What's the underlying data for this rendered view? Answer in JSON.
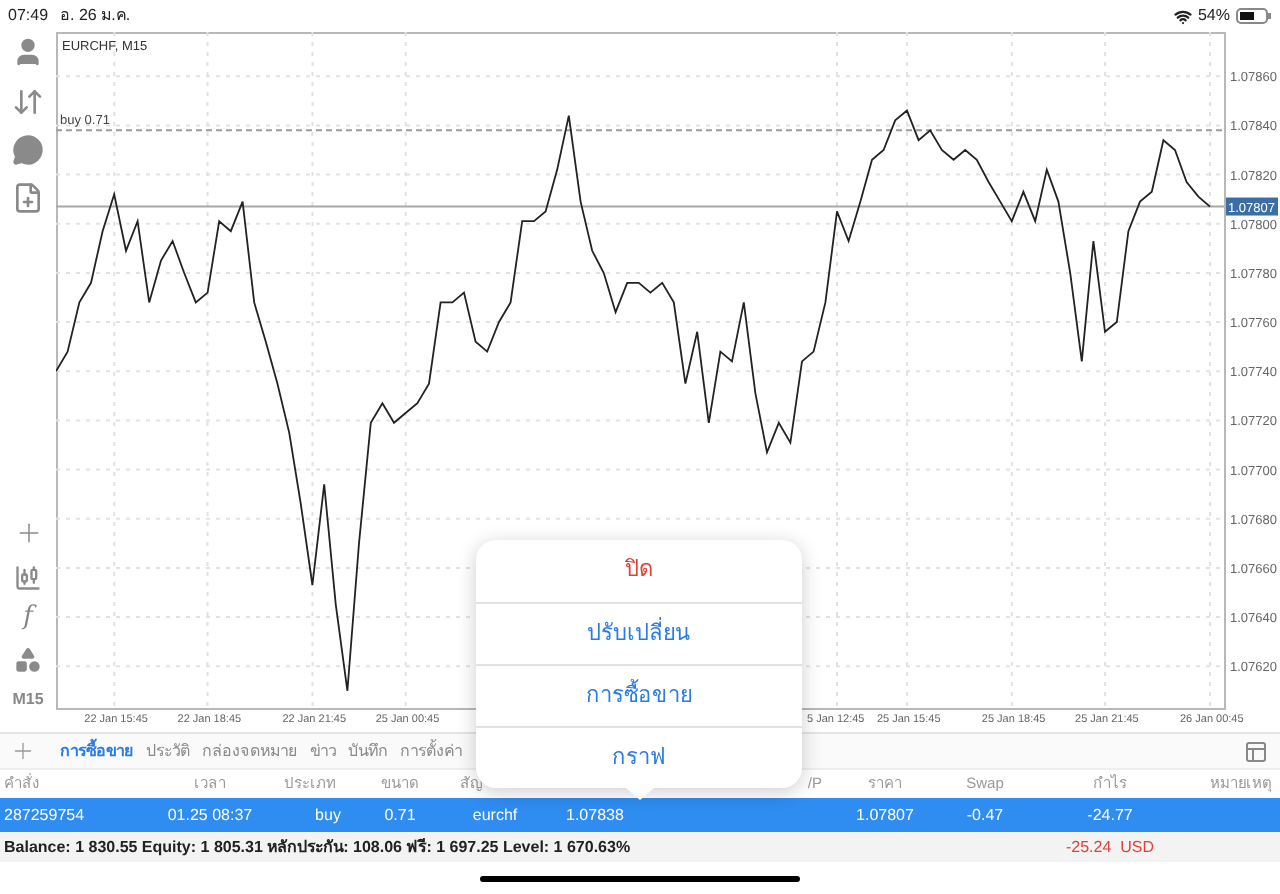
{
  "status_bar": {
    "time": "07:49",
    "date": "อ. 26 ม.ค.",
    "battery": "54%"
  },
  "toolbar": {
    "function_glyph": "f",
    "timeframe": "M15"
  },
  "chart": {
    "title": "EURCHF, M15",
    "chart_data": {
      "type": "line",
      "grid": true,
      "ylim": [
        1.07603,
        1.07878
      ],
      "categories": [
        null,
        null,
        null,
        null,
        null,
        "22 Jan 15:45",
        null,
        null,
        null,
        null,
        null,
        null,
        null,
        "22 Jan 18:45",
        null,
        null,
        null,
        null,
        null,
        null,
        null,
        null,
        "22 Jan 21:45",
        null,
        null,
        null,
        null,
        null,
        null,
        null,
        "25 Jan 00:45",
        null,
        null,
        null,
        null,
        null,
        null,
        null,
        null,
        null,
        null,
        null,
        null,
        null,
        null,
        null,
        null,
        null,
        null,
        null,
        null,
        null,
        null,
        null,
        null,
        null,
        null,
        null,
        null,
        null,
        null,
        null,
        null,
        null,
        null,
        null,
        null,
        "5 Jan 12:45",
        null,
        null,
        null,
        null,
        null,
        "25 Jan 15:45",
        null,
        null,
        null,
        null,
        null,
        null,
        null,
        null,
        "25 Jan 18:45",
        null,
        null,
        null,
        null,
        null,
        null,
        null,
        "25 Jan 21:45",
        null,
        null,
        null,
        null,
        null,
        null,
        null,
        null,
        "26 Jan 00:45"
      ],
      "yticks": [
        {
          "value": 1.0762,
          "label": "1.07620"
        },
        {
          "value": 1.0764,
          "label": "1.07640"
        },
        {
          "value": 1.0766,
          "label": "1.07660"
        },
        {
          "value": 1.0768,
          "label": "1.07680"
        },
        {
          "value": 1.077,
          "label": "1.07700"
        },
        {
          "value": 1.0772,
          "label": "1.07720"
        },
        {
          "value": 1.0774,
          "label": "1.07740"
        },
        {
          "value": 1.0776,
          "label": "1.07760"
        },
        {
          "value": 1.0778,
          "label": "1.07780"
        },
        {
          "value": 1.078,
          "label": "1.07800"
        },
        {
          "value": 1.0782,
          "label": "1.07820"
        },
        {
          "value": 1.0784,
          "label": "1.07840"
        },
        {
          "value": 1.0786,
          "label": "1.07860"
        }
      ],
      "series": [
        {
          "color": "#222222",
          "values": [
            1.0774,
            1.07748,
            1.07768,
            1.07776,
            1.07797,
            1.07812,
            1.07789,
            1.07801,
            1.07768,
            1.07785,
            1.07793,
            1.0778,
            1.07768,
            1.07772,
            1.07801,
            1.07797,
            1.07809,
            1.07768,
            1.07752,
            1.07735,
            1.07715,
            1.07686,
            1.07653,
            1.07694,
            1.07645,
            1.0761,
            1.0767,
            1.07719,
            1.07727,
            1.07719,
            1.07723,
            1.07727,
            1.07735,
            1.07768,
            1.07768,
            1.07772,
            1.07752,
            1.07748,
            1.0776,
            1.07768,
            1.07801,
            1.07801,
            1.07805,
            1.07822,
            1.07844,
            1.07809,
            1.07789,
            1.0778,
            1.07764,
            1.07776,
            1.07776,
            1.07772,
            1.07776,
            1.07768,
            1.07735,
            1.07756,
            1.07719,
            1.07748,
            1.07744,
            1.07768,
            1.07731,
            1.07707,
            1.07719,
            1.07711,
            1.07744,
            1.07748,
            1.07768,
            1.07805,
            1.07793,
            1.07809,
            1.07826,
            1.0783,
            1.07842,
            1.07846,
            1.07834,
            1.07838,
            1.0783,
            1.07826,
            1.0783,
            1.07826,
            1.07817,
            1.07809,
            1.07801,
            1.07813,
            1.07801,
            1.07822,
            1.07809,
            1.0778,
            1.07744,
            1.07793,
            1.07756,
            1.0776,
            1.07797,
            1.07809,
            1.07813,
            1.07834,
            1.0783,
            1.07817,
            1.07811,
            1.07807
          ]
        }
      ],
      "ref_lines": [
        {
          "axis": "y",
          "value": 1.07838,
          "label": "buy 0.71"
        },
        {
          "axis": "y",
          "value": 1.07807,
          "label": "1.07807"
        }
      ]
    }
  },
  "tabs": [
    {
      "label": "การซื้อขาย",
      "selected": true
    },
    {
      "label": "ประวัติ",
      "selected": false
    },
    {
      "label": "กล่องจดหมาย",
      "selected": false
    },
    {
      "label": "ข่าว",
      "selected": false
    },
    {
      "label": "บันทึก",
      "selected": false
    },
    {
      "label": "การตั้งค่า",
      "selected": false
    }
  ],
  "table": {
    "columns": [
      "คำสั่ง",
      "เวลา",
      "ประเภท",
      "ขนาด",
      "สัญ",
      "",
      "",
      "/P",
      "ราคา",
      "Swap",
      "กำไร",
      "หมายเหตุ"
    ],
    "rows": [
      {
        "selected": true,
        "cells": [
          "287259754",
          "01.25 08:37",
          "buy",
          "0.71",
          "eurchf",
          "1.07838",
          "",
          "",
          "1.07807",
          "-0.47",
          "-24.77",
          ""
        ]
      }
    ],
    "summary": {
      "text": "Balance: 1 830.55 Equity: 1 805.31 หลักประกัน: 108.06 ฟรี: 1 697.25 Level: 1 670.63%",
      "total": "-25.24  USD"
    }
  },
  "popup_menu": {
    "items": [
      {
        "label": "ปิด",
        "kind": "destructive"
      },
      {
        "label": "ปรับเปลี่ยน",
        "kind": "action"
      },
      {
        "label": "การซื้อขาย",
        "kind": "action"
      },
      {
        "label": "กราฟ",
        "kind": "action"
      }
    ]
  }
}
